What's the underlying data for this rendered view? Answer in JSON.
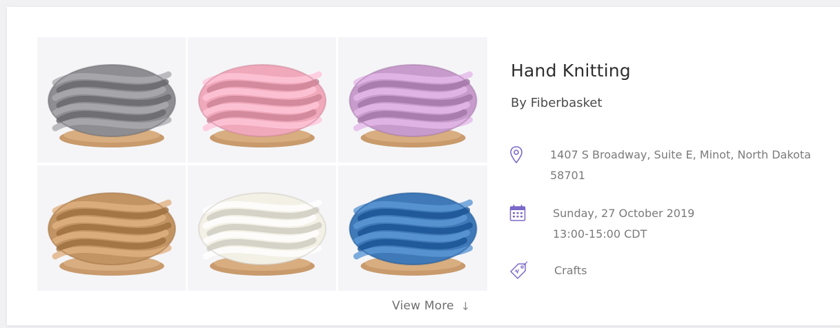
{
  "event": {
    "title": "Hand Knitting",
    "organizer": "By Fiberbasket",
    "address_line1": "1407 S Broadway, Suite E, Minot, North Dakota",
    "address_line2": "58701",
    "date": "Sunday, 27 October 2019",
    "time": "13:00-15:00 CDT",
    "category": "Crafts"
  },
  "gallery": {
    "view_more_label": "View More",
    "arrow": "↓",
    "yarn_colors": [
      "#8e8e92",
      "#f0a8bb",
      "#c79bcb",
      "#c39463",
      "#f3f0e6",
      "#3f79b8"
    ]
  },
  "icons": {
    "location": "map-pin-icon",
    "date": "calendar-icon",
    "category": "tag-icon",
    "accent_color": "#7b68c8"
  }
}
